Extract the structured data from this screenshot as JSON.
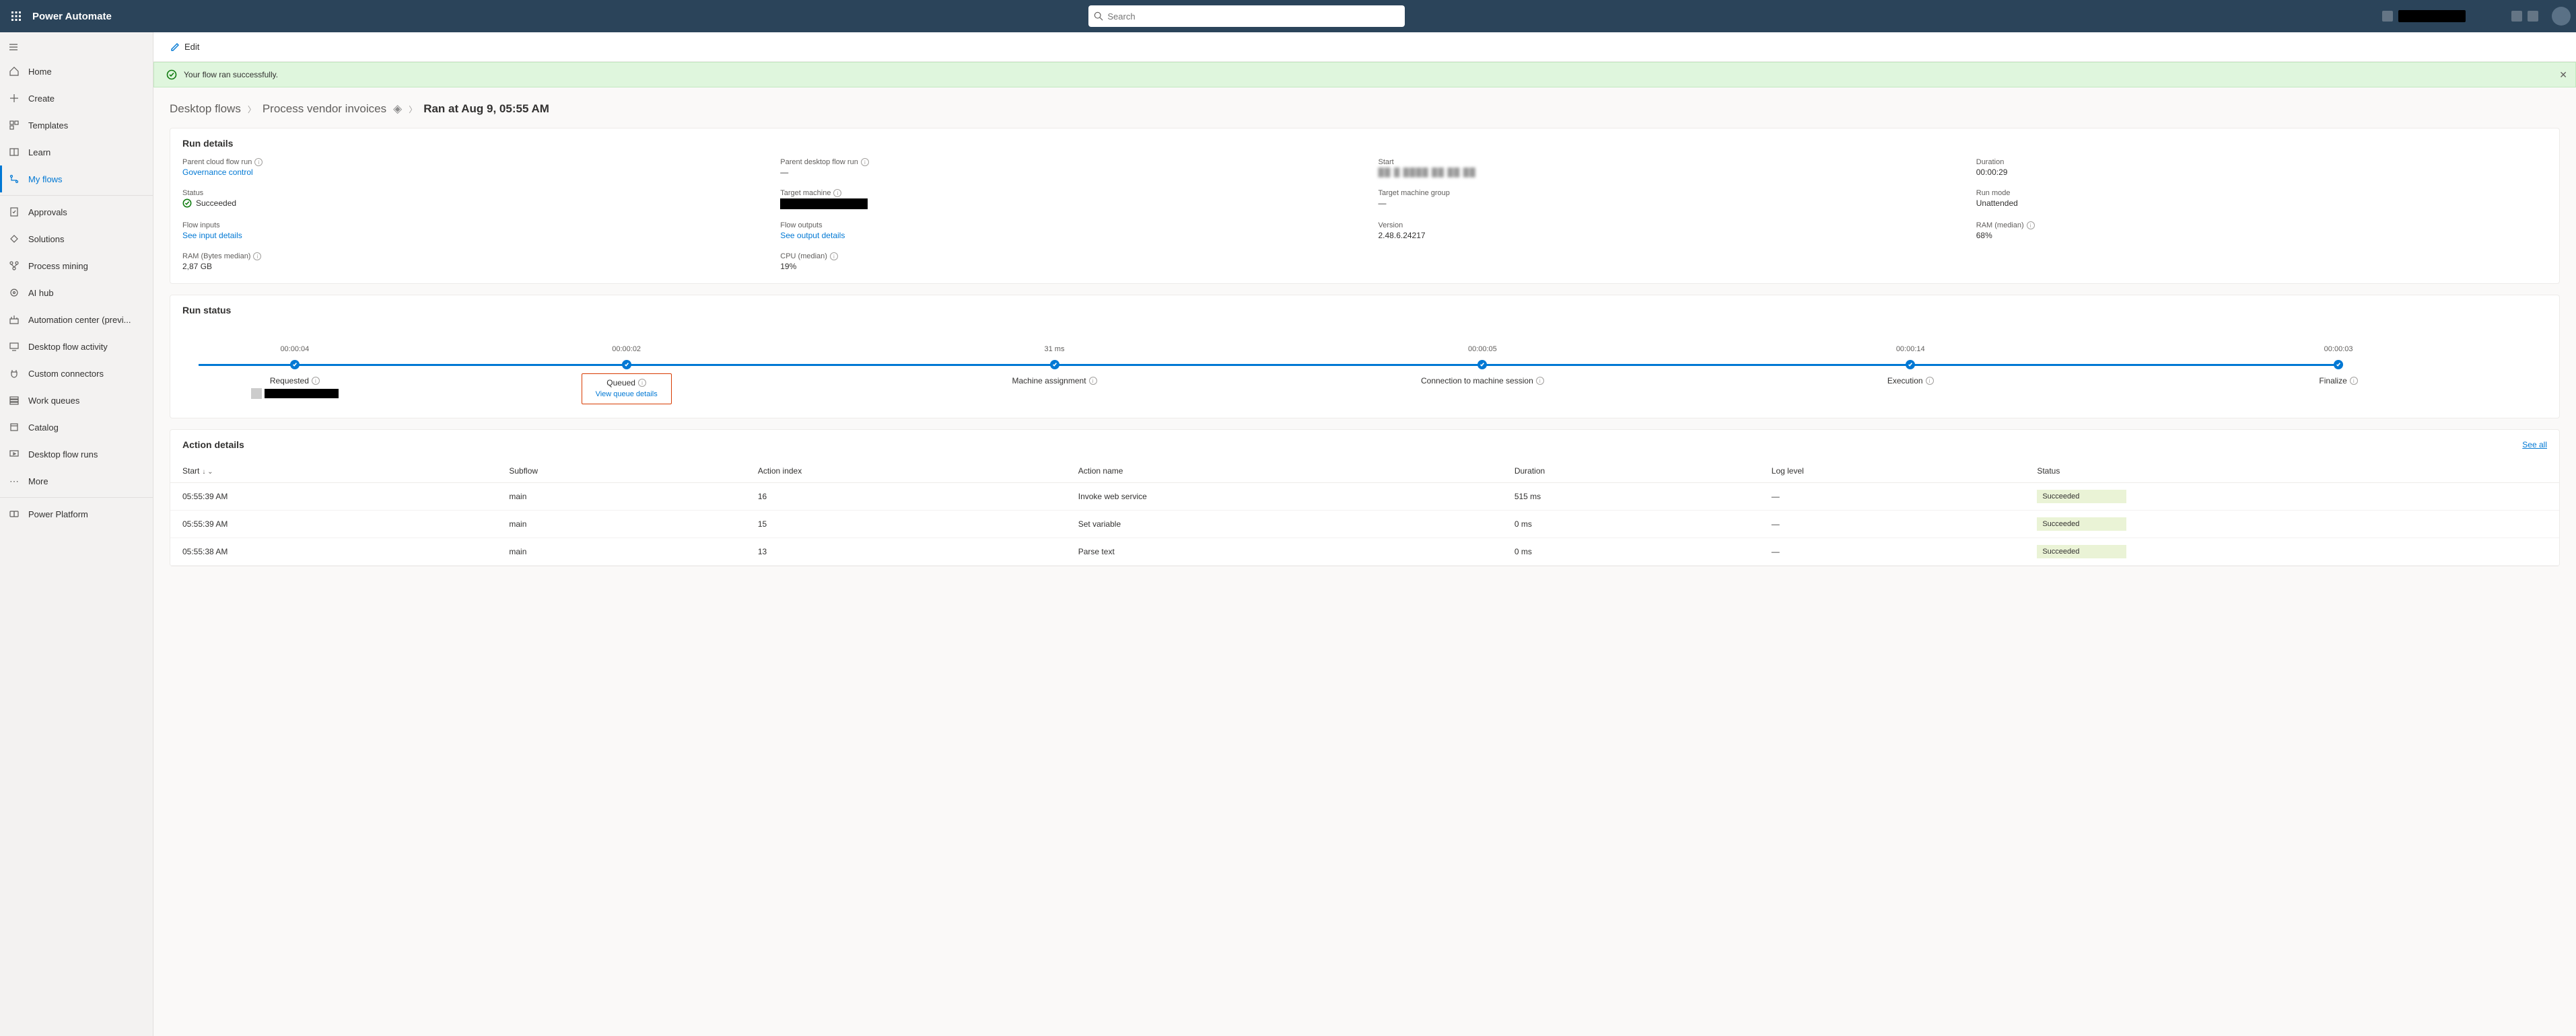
{
  "brand": "Power Automate",
  "search_placeholder": "Search",
  "sidebar": {
    "items": [
      {
        "label": "Home"
      },
      {
        "label": "Create"
      },
      {
        "label": "Templates"
      },
      {
        "label": "Learn"
      },
      {
        "label": "My flows"
      },
      {
        "label": "Approvals"
      },
      {
        "label": "Solutions"
      },
      {
        "label": "Process mining"
      },
      {
        "label": "AI hub"
      },
      {
        "label": "Automation center (previ..."
      },
      {
        "label": "Desktop flow activity"
      },
      {
        "label": "Custom connectors"
      },
      {
        "label": "Work queues"
      },
      {
        "label": "Catalog"
      },
      {
        "label": "Desktop flow runs"
      },
      {
        "label": "More"
      }
    ],
    "footer": "Power Platform"
  },
  "cmdbar": {
    "edit": "Edit"
  },
  "banner": "Your flow ran successfully.",
  "crumbs": {
    "a": "Desktop flows",
    "b": "Process vendor invoices",
    "current": "Ran at Aug 9, 05:55 AM"
  },
  "run_details": {
    "title": "Run details",
    "fields": {
      "parent_cloud": "Parent cloud flow run",
      "parent_cloud_val": "Governance control",
      "parent_desktop": "Parent desktop flow run",
      "parent_desktop_val": "—",
      "start": "Start",
      "duration": "Duration",
      "duration_val": "00:00:29",
      "status": "Status",
      "status_val": "Succeeded",
      "target_machine": "Target machine",
      "target_group": "Target machine group",
      "target_group_val": "—",
      "run_mode": "Run mode",
      "run_mode_val": "Unattended",
      "flow_inputs": "Flow inputs",
      "flow_inputs_val": "See input details",
      "flow_outputs": "Flow outputs",
      "flow_outputs_val": "See output details",
      "version": "Version",
      "version_val": "2.48.6.24217",
      "ram_median": "RAM (median)",
      "ram_median_val": "68%",
      "ram_bytes": "RAM (Bytes median)",
      "ram_bytes_val": "2,87 GB",
      "cpu_median": "CPU (median)",
      "cpu_median_val": "19%"
    }
  },
  "run_status": {
    "title": "Run status",
    "steps": [
      {
        "time": "00:00:04",
        "label": "Requested"
      },
      {
        "time": "00:00:02",
        "label": "Queued",
        "link": "View queue details"
      },
      {
        "time": "31 ms",
        "label": "Machine assignment"
      },
      {
        "time": "00:00:05",
        "label": "Connection to machine session"
      },
      {
        "time": "00:00:14",
        "label": "Execution"
      },
      {
        "time": "00:00:03",
        "label": "Finalize"
      }
    ]
  },
  "action_details": {
    "title": "Action details",
    "see_all": "See all",
    "cols": {
      "start": "Start",
      "subflow": "Subflow",
      "index": "Action index",
      "name": "Action name",
      "duration": "Duration",
      "log": "Log level",
      "status": "Status"
    },
    "rows": [
      {
        "start": "05:55:39 AM",
        "subflow": "main",
        "index": "16",
        "name": "Invoke web service",
        "duration": "515 ms",
        "log": "—",
        "status": "Succeeded"
      },
      {
        "start": "05:55:39 AM",
        "subflow": "main",
        "index": "15",
        "name": "Set variable",
        "duration": "0 ms",
        "log": "—",
        "status": "Succeeded"
      },
      {
        "start": "05:55:38 AM",
        "subflow": "main",
        "index": "13",
        "name": "Parse text",
        "duration": "0 ms",
        "log": "—",
        "status": "Succeeded"
      }
    ]
  }
}
